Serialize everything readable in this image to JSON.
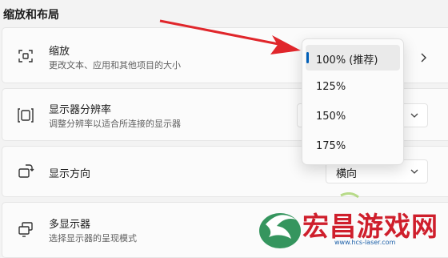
{
  "section": {
    "title": "缩放和布局"
  },
  "cards": {
    "scale": {
      "title": "缩放",
      "subtitle": "更改文本、应用和其他项目的大小"
    },
    "resolution": {
      "title": "显示器分辨率",
      "subtitle": "调整分辨率以适合所连接的显示器"
    },
    "orientation": {
      "title": "显示方向",
      "value": "横向"
    },
    "multi": {
      "title": "多显示器",
      "subtitle": "选择显示器的呈现模式"
    }
  },
  "scale_menu": {
    "options": [
      "100% (推荐)",
      "125%",
      "150%",
      "175%"
    ],
    "selected_index": 0
  },
  "icons": {
    "scale": "resize-icon",
    "resolution": "display-resolution-icon",
    "orientation": "rotate-display-icon",
    "multi": "multiple-displays-icon",
    "arrow": "red-annotation-arrow"
  },
  "colors": {
    "accent": "#005fb8",
    "arrow": "#e0262b",
    "watermark": "#cf1f2c"
  },
  "watermark": {
    "text": "宏昌游戏网",
    "url": "www.hcs-laser.com"
  }
}
